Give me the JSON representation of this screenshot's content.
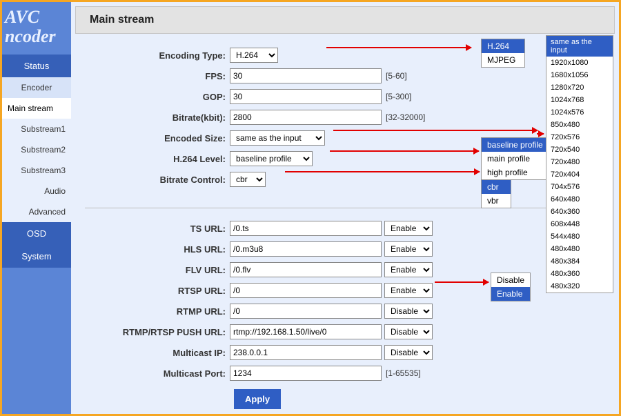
{
  "brand": {
    "line1": "AVC",
    "line2": "ncoder"
  },
  "nav": {
    "status": "Status",
    "encoder": "Encoder",
    "mainstream": "Main stream",
    "sub1": "Substream1",
    "sub2": "Substream2",
    "sub3": "Substream3",
    "audio": "Audio",
    "advanced": "Advanced",
    "osd": "OSD",
    "system": "System"
  },
  "title": "Main stream",
  "labels": {
    "encoding_type": "Encoding Type:",
    "fps": "FPS:",
    "gop": "GOP:",
    "bitrate": "Bitrate(kbit):",
    "encoded_size": "Encoded Size:",
    "h264_level": "H.264 Level:",
    "bitrate_control": "Bitrate Control:",
    "ts_url": "TS URL:",
    "hls_url": "HLS URL:",
    "flv_url": "FLV URL:",
    "rtsp_url": "RTSP URL:",
    "rtmp_url": "RTMP URL:",
    "push_url": "RTMP/RTSP PUSH URL:",
    "multicast_ip": "Multicast IP:",
    "multicast_port": "Multicast Port:"
  },
  "values": {
    "encoding_type": "H.264",
    "fps": "30",
    "gop": "30",
    "bitrate": "2800",
    "encoded_size": "same as the input",
    "h264_level": "baseline profile",
    "bitrate_control": "cbr",
    "ts_url": "/0.ts",
    "hls_url": "/0.m3u8",
    "flv_url": "/0.flv",
    "rtsp_url": "/0",
    "rtmp_url": "/0",
    "push_url": "rtmp://192.168.1.50/live/0",
    "multicast_ip": "238.0.0.1",
    "multicast_port": "1234",
    "ts_enable": "Enable",
    "hls_enable": "Enable",
    "flv_enable": "Enable",
    "rtsp_enable": "Enable",
    "rtmp_enable": "Disable",
    "push_enable": "Disable",
    "multicast_enable": "Disable"
  },
  "hints": {
    "fps": "[5-60]",
    "gop": "[5-300]",
    "bitrate": "[32-32000]",
    "multicast_port": "[1-65535]"
  },
  "apply": "Apply",
  "popups": {
    "encoding": {
      "options": [
        "H.264",
        "MJPEG"
      ],
      "selected": "H.264"
    },
    "profile": {
      "options": [
        "baseline profile",
        "main profile",
        "high profile"
      ],
      "selected": "baseline profile"
    },
    "brc": {
      "options": [
        "cbr",
        "vbr"
      ],
      "selected": "cbr"
    },
    "enable": {
      "options": [
        "Disable",
        "Enable"
      ],
      "selected": "Enable"
    },
    "resolutions": {
      "selected": "same as the input",
      "options": [
        "same as the input",
        "1920x1080",
        "1680x1056",
        "1280x720",
        "1024x768",
        "1024x576",
        "850x480",
        "720x576",
        "720x540",
        "720x480",
        "720x404",
        "704x576",
        "640x480",
        "640x360",
        "608x448",
        "544x480",
        "480x480",
        "480x384",
        "480x360",
        "480x320"
      ]
    }
  },
  "select_opts": {
    "enable": [
      "Enable",
      "Disable"
    ]
  }
}
